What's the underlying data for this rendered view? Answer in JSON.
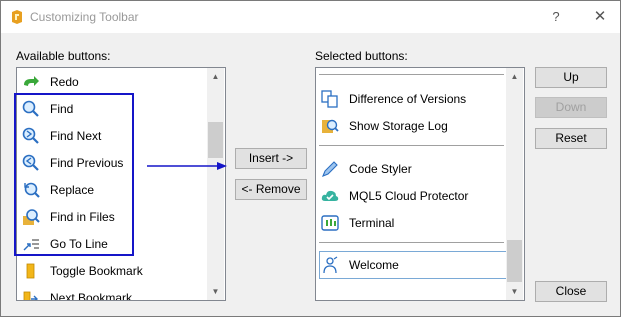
{
  "window": {
    "title": "Customizing Toolbar",
    "help_symbol": "?",
    "close_symbol": "✕"
  },
  "available": {
    "label": "Available buttons:",
    "items": [
      {
        "label": "Redo",
        "icon": "redo-icon"
      },
      {
        "label": "Find",
        "icon": "find-icon"
      },
      {
        "label": "Find Next",
        "icon": "find-next-icon"
      },
      {
        "label": "Find Previous",
        "icon": "find-previous-icon"
      },
      {
        "label": "Replace",
        "icon": "replace-icon"
      },
      {
        "label": "Find in Files",
        "icon": "find-in-files-icon"
      },
      {
        "label": "Go To Line",
        "icon": "go-to-line-icon"
      },
      {
        "label": "Toggle Bookmark",
        "icon": "bookmark-icon"
      },
      {
        "label": "Next Bookmark",
        "icon": "next-bookmark-icon"
      }
    ]
  },
  "selected": {
    "label": "Selected buttons:",
    "items": [
      {
        "label": "Difference of Versions",
        "icon": "versions-icon"
      },
      {
        "label": "Show Storage Log",
        "icon": "storage-log-icon"
      },
      {
        "label": "Code Styler",
        "icon": "code-styler-icon"
      },
      {
        "label": "MQL5 Cloud Protector",
        "icon": "cloud-protector-icon"
      },
      {
        "label": "Terminal",
        "icon": "terminal-icon"
      },
      {
        "label": "Welcome",
        "icon": "welcome-icon"
      }
    ]
  },
  "buttons": {
    "insert": "Insert ->",
    "remove": "<- Remove",
    "up": "Up",
    "down": "Down",
    "reset": "Reset",
    "close": "Close"
  },
  "colors": {
    "annotation": "#1515c8",
    "selection_border": "#7aa9d6"
  }
}
